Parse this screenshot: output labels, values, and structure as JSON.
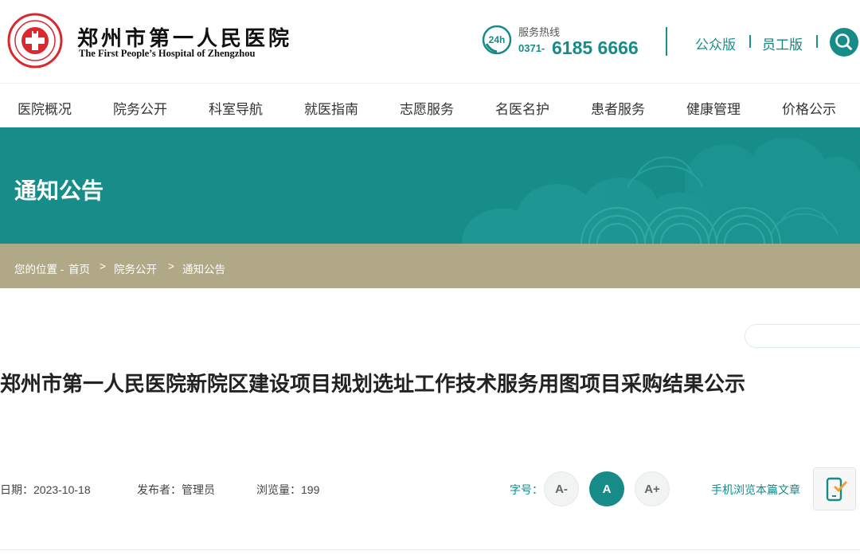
{
  "header": {
    "logo_cn": "郑州市第一人民医院",
    "logo_en": "The First People’s Hospital of Zhengzhou",
    "hotline_badge": "24h",
    "hotline_label": "服务热线",
    "hotline_prefix": "0371-",
    "hotline_number": "6185 6666",
    "link_public": "公众版",
    "link_staff": "员工版"
  },
  "nav": {
    "items": [
      {
        "label": "医院概况"
      },
      {
        "label": "院务公开"
      },
      {
        "label": "科室导航"
      },
      {
        "label": "就医指南"
      },
      {
        "label": "志愿服务"
      },
      {
        "label": "名医名护"
      },
      {
        "label": "患者服务"
      },
      {
        "label": "健康管理"
      },
      {
        "label": "价格公示"
      }
    ]
  },
  "banner": {
    "title": "通知公告"
  },
  "breadcrumb": {
    "lead": "您的位置 -",
    "items": [
      "首页",
      "院务公开",
      "通知公告"
    ],
    "separator": ">"
  },
  "article": {
    "title": "郑州市第一人民医院新院区建设项目规划选址工作技术服务用图项目采购结果公示",
    "date": "日期：2023-10-18",
    "publisher": "发布者：管理员",
    "views": "浏览量：199"
  },
  "font_size": {
    "label": "字号：",
    "smaller": "A-",
    "normal": "A",
    "larger": "A+",
    "selected": "A"
  },
  "mobile": {
    "label": "手机浏览本篇文章"
  },
  "icons": {
    "emblem": "hospital-emblem-icon",
    "hotline": "hotline-24h-icon",
    "search": "search-icon",
    "mobile": "mobile-check-icon"
  },
  "colors": {
    "brand_teal": "#168b88",
    "banner": "#178d8a",
    "breadcrumb_bar": "#b0a887",
    "logo_red": "#d9282e"
  }
}
